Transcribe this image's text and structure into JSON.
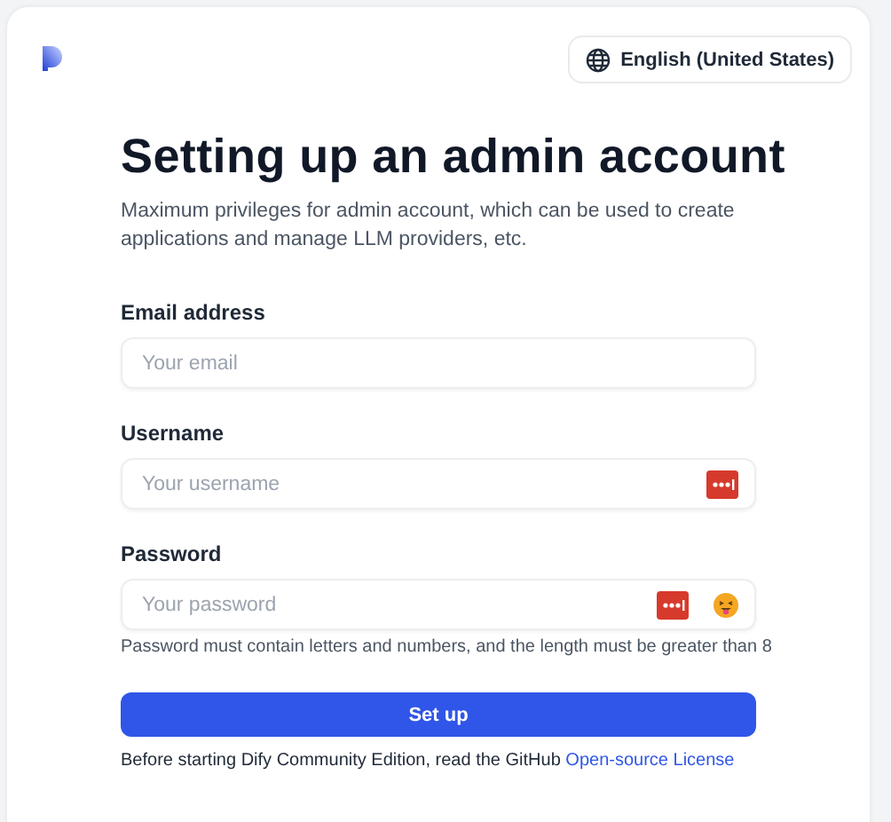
{
  "language": {
    "label": "English (United States)"
  },
  "title": "Setting up an admin account",
  "description": "Maximum privileges for admin account, which can be used to create applications and manage LLM providers, etc.",
  "fields": [
    {
      "kind": "email",
      "label": "Email address",
      "placeholder": "Your email"
    },
    {
      "kind": "username",
      "label": "Username",
      "placeholder": "Your username"
    },
    {
      "kind": "password",
      "label": "Password",
      "placeholder": "Your password",
      "hint": "Password must contain letters and numbers, and the length must be greater than 8"
    }
  ],
  "submit": "Set up",
  "footer": {
    "text": "Before starting Dify Community Edition, read the GitHub",
    "link": "Open-source License"
  }
}
